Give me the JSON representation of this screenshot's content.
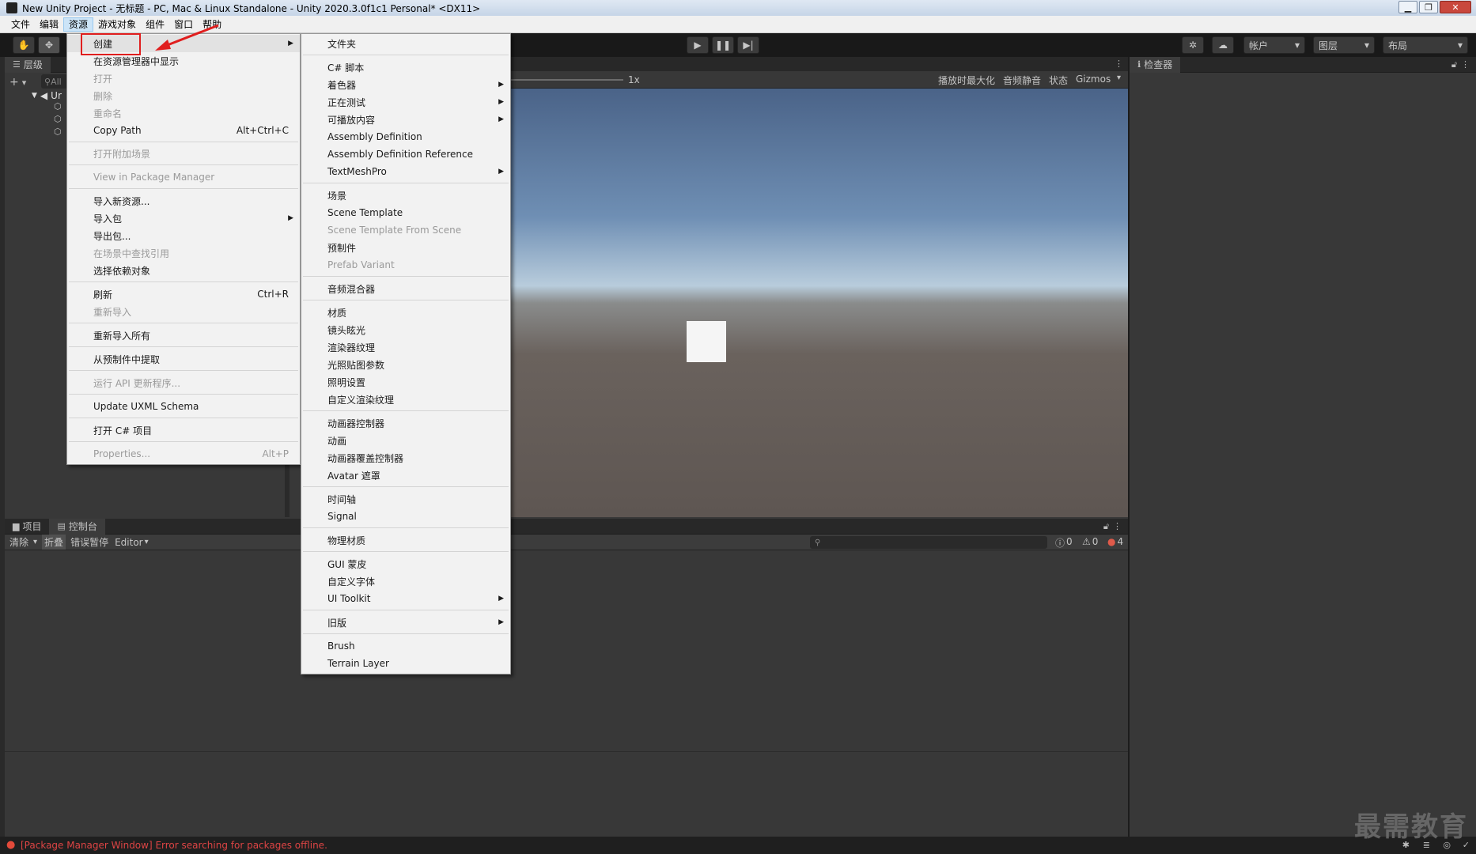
{
  "window": {
    "title": "New Unity Project - 无标题 - PC, Mac & Linux Standalone - Unity 2020.3.0f1c1 Personal* <DX11>"
  },
  "menubar": [
    "文件",
    "编辑",
    "资源",
    "游戏对象",
    "组件",
    "窗口",
    "帮助"
  ],
  "toolbar": {
    "account": "帐户",
    "layers": "图层",
    "layout": "布局"
  },
  "hierarchy": {
    "tab": "层级",
    "search_placeholder": "All",
    "root": "Ur"
  },
  "scene": {
    "scale": "1x",
    "maximize_on_play": "播放时最大化",
    "mute_audio": "音频静音",
    "stats": "状态",
    "gizmos": "Gizmos"
  },
  "inspector": {
    "tab": "检查器"
  },
  "bottom": {
    "tab_project": "项目",
    "tab_console": "控制台",
    "clear": "清除",
    "collapse": "折叠",
    "error_pause": "错误暂停",
    "editor": "Editor",
    "count_info": "0",
    "count_warn": "0",
    "count_error": "4"
  },
  "assets_menu": [
    {
      "label": "创建",
      "submenu": true,
      "highlight": true
    },
    {
      "label": "在资源管理器中显示"
    },
    {
      "label": "打开",
      "disabled": true
    },
    {
      "label": "删除",
      "disabled": true
    },
    {
      "label": "重命名",
      "disabled": true
    },
    {
      "label": "Copy Path",
      "shortcut": "Alt+Ctrl+C"
    },
    {
      "label": "打开附加场景",
      "disabled": true
    },
    {
      "label": "View in Package Manager",
      "disabled": true
    },
    {
      "label": "导入新资源..."
    },
    {
      "label": "导入包",
      "submenu": true
    },
    {
      "label": "导出包..."
    },
    {
      "label": "在场景中查找引用",
      "disabled": true
    },
    {
      "label": "选择依赖对象"
    },
    {
      "label": "刷新",
      "shortcut": "Ctrl+R"
    },
    {
      "label": "重新导入",
      "disabled": true
    },
    {
      "label": "重新导入所有"
    },
    {
      "label": "从预制件中提取"
    },
    {
      "label": "运行 API 更新程序...",
      "disabled": true
    },
    {
      "label": "Update UXML Schema"
    },
    {
      "label": "打开 C# 项目"
    },
    {
      "label": "Properties...",
      "shortcut": "Alt+P",
      "disabled": true
    }
  ],
  "create_menu": [
    {
      "label": "文件夹"
    },
    {
      "label": "C# 脚本"
    },
    {
      "label": "着色器",
      "submenu": true
    },
    {
      "label": "正在测试",
      "submenu": true
    },
    {
      "label": "可播放内容",
      "submenu": true
    },
    {
      "label": "Assembly Definition"
    },
    {
      "label": "Assembly Definition Reference"
    },
    {
      "label": "TextMeshPro",
      "submenu": true
    },
    {
      "label": "场景"
    },
    {
      "label": "Scene Template"
    },
    {
      "label": "Scene Template From Scene",
      "disabled": true
    },
    {
      "label": "预制件"
    },
    {
      "label": "Prefab Variant",
      "disabled": true
    },
    {
      "label": "音频混合器"
    },
    {
      "label": "材质"
    },
    {
      "label": "镜头眩光"
    },
    {
      "label": "渲染器纹理"
    },
    {
      "label": "光照贴图参数"
    },
    {
      "label": "照明设置"
    },
    {
      "label": "自定义渲染纹理"
    },
    {
      "label": "动画器控制器"
    },
    {
      "label": "动画"
    },
    {
      "label": "动画器覆盖控制器"
    },
    {
      "label": "Avatar 遮罩"
    },
    {
      "label": "时间轴"
    },
    {
      "label": "Signal"
    },
    {
      "label": "物理材质"
    },
    {
      "label": "GUI 蒙皮"
    },
    {
      "label": "自定义字体"
    },
    {
      "label": "UI Toolkit",
      "submenu": true
    },
    {
      "label": "旧版",
      "submenu": true
    },
    {
      "label": "Brush"
    },
    {
      "label": "Terrain Layer"
    }
  ],
  "status": {
    "message": "[Package Manager Window] Error searching for packages offline."
  },
  "watermark": "最需教育"
}
